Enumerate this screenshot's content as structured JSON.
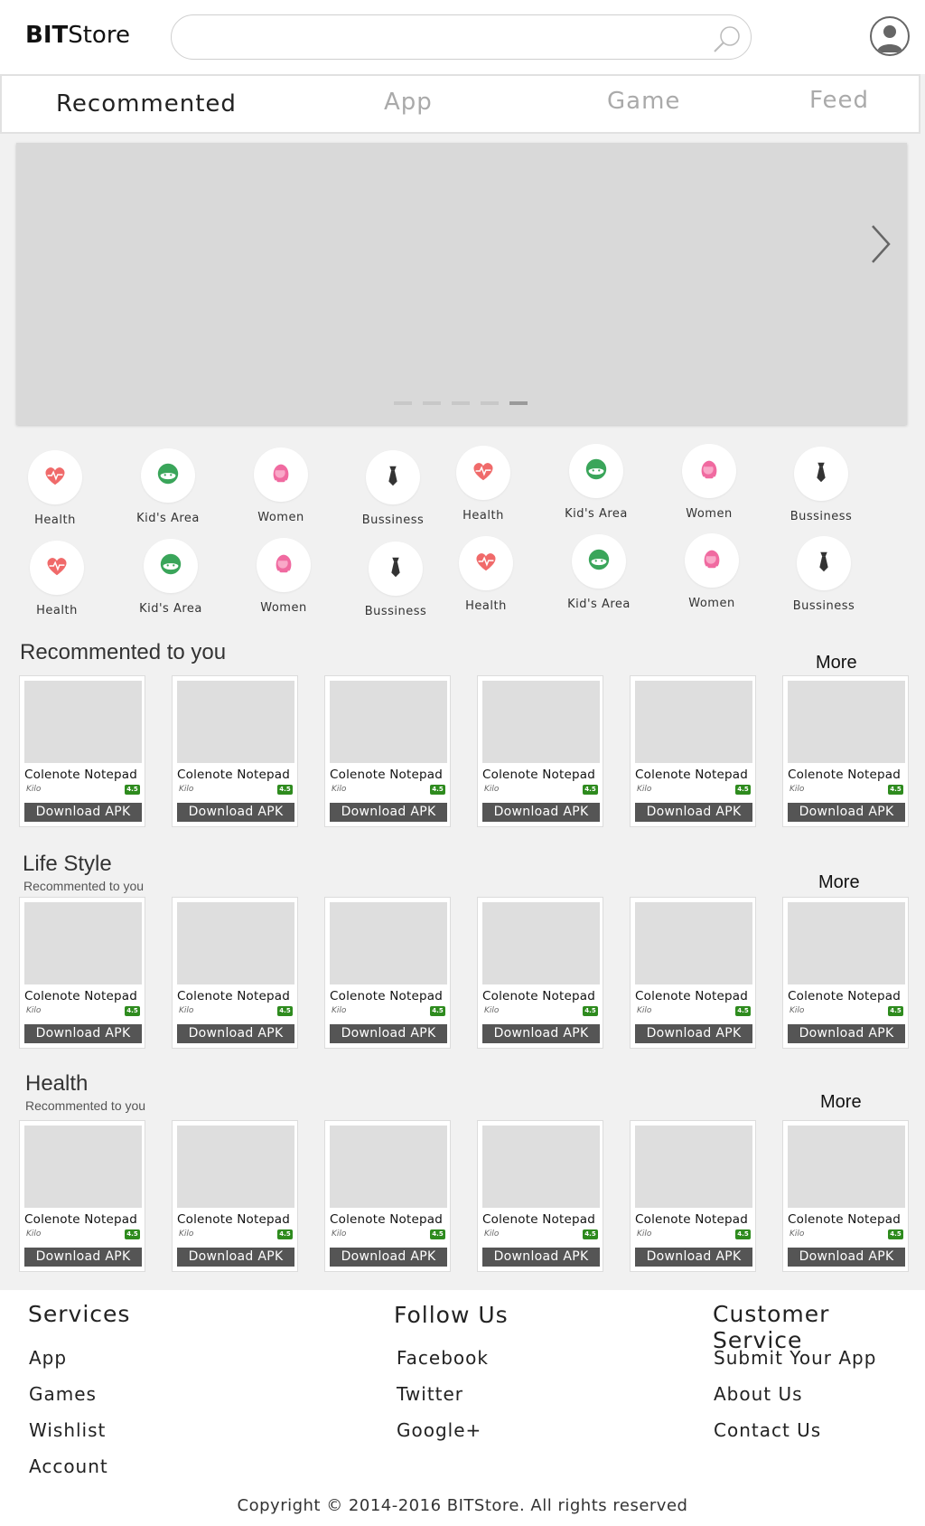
{
  "header": {
    "logo_bold": "BIT",
    "logo_rest": "Store",
    "search_placeholder": ""
  },
  "tabs": [
    {
      "label": "Recommented",
      "active": true
    },
    {
      "label": "App",
      "active": false
    },
    {
      "label": "Game",
      "active": false
    },
    {
      "label": "Feed",
      "active": false
    }
  ],
  "banner": {
    "slide_count": 5,
    "active_slide": 5
  },
  "categories": [
    {
      "label": "Health",
      "icon": "heart-pulse-icon"
    },
    {
      "label": "Kid's Area",
      "icon": "kid-face-icon"
    },
    {
      "label": "Women",
      "icon": "woman-icon"
    },
    {
      "label": "Bussiness",
      "icon": "tie-icon"
    },
    {
      "label": "Health",
      "icon": "heart-pulse-icon"
    },
    {
      "label": "Kid's Area",
      "icon": "kid-face-icon"
    },
    {
      "label": "Women",
      "icon": "woman-icon"
    },
    {
      "label": "Bussiness",
      "icon": "tie-icon"
    },
    {
      "label": "Health",
      "icon": "heart-pulse-icon"
    },
    {
      "label": "Kid's Area",
      "icon": "kid-face-icon"
    },
    {
      "label": "Women",
      "icon": "woman-icon"
    },
    {
      "label": "Bussiness",
      "icon": "tie-icon"
    },
    {
      "label": "Health",
      "icon": "heart-pulse-icon"
    },
    {
      "label": "Kid's Area",
      "icon": "kid-face-icon"
    },
    {
      "label": "Women",
      "icon": "woman-icon"
    },
    {
      "label": "Bussiness",
      "icon": "tie-icon"
    }
  ],
  "sections": [
    {
      "title": "Recommented to you",
      "subtitle": "",
      "more": "More",
      "apps": [
        {
          "name": "Colenote Notepad",
          "dev": "Kilo",
          "rating": "4.5",
          "button": "Download APK"
        },
        {
          "name": "Colenote Notepad",
          "dev": "Kilo",
          "rating": "4.5",
          "button": "Download APK"
        },
        {
          "name": "Colenote Notepad",
          "dev": "Kilo",
          "rating": "4.5",
          "button": "Download APK"
        },
        {
          "name": "Colenote Notepad",
          "dev": "Kilo",
          "rating": "4.5",
          "button": "Download APK"
        },
        {
          "name": "Colenote Notepad",
          "dev": "Kilo",
          "rating": "4.5",
          "button": "Download APK"
        },
        {
          "name": "Colenote Notepad",
          "dev": "Kilo",
          "rating": "4.5",
          "button": "Download APK"
        }
      ]
    },
    {
      "title": "Life Style",
      "subtitle": "Recommented to you",
      "more": "More",
      "apps": [
        {
          "name": "Colenote Notepad",
          "dev": "Kilo",
          "rating": "4.5",
          "button": "Download APK"
        },
        {
          "name": "Colenote Notepad",
          "dev": "Kilo",
          "rating": "4.5",
          "button": "Download APK"
        },
        {
          "name": "Colenote Notepad",
          "dev": "Kilo",
          "rating": "4.5",
          "button": "Download APK"
        },
        {
          "name": "Colenote Notepad",
          "dev": "Kilo",
          "rating": "4.5",
          "button": "Download APK"
        },
        {
          "name": "Colenote Notepad",
          "dev": "Kilo",
          "rating": "4.5",
          "button": "Download APK"
        },
        {
          "name": "Colenote Notepad",
          "dev": "Kilo",
          "rating": "4.5",
          "button": "Download APK"
        }
      ]
    },
    {
      "title": "Health",
      "subtitle": "Recommented to you",
      "more": "More",
      "apps": [
        {
          "name": "Colenote Notepad",
          "dev": "Kilo",
          "rating": "4.5",
          "button": "Download APK"
        },
        {
          "name": "Colenote Notepad",
          "dev": "Kilo",
          "rating": "4.5",
          "button": "Download APK"
        },
        {
          "name": "Colenote Notepad",
          "dev": "Kilo",
          "rating": "4.5",
          "button": "Download APK"
        },
        {
          "name": "Colenote Notepad",
          "dev": "Kilo",
          "rating": "4.5",
          "button": "Download APK"
        },
        {
          "name": "Colenote Notepad",
          "dev": "Kilo",
          "rating": "4.5",
          "button": "Download APK"
        },
        {
          "name": "Colenote Notepad",
          "dev": "Kilo",
          "rating": "4.5",
          "button": "Download APK"
        }
      ]
    }
  ],
  "footer": {
    "columns": [
      {
        "heading": "Services",
        "links": [
          "App",
          "Games",
          "Wishlist",
          "Account"
        ]
      },
      {
        "heading": "Follow Us",
        "links": [
          "Facebook",
          "Twitter",
          "Google+"
        ]
      },
      {
        "heading": "Customer Service",
        "links": [
          "Submit Your App",
          "About Us",
          "Contact Us"
        ]
      }
    ],
    "copyright": "Copyright © 2014-2016 BITStore. All rights reserved"
  },
  "colors": {
    "rating_badge": "#2e8b1e",
    "button_bg": "#555555",
    "health_icon": "#f06a6a",
    "kid_icon": "#3aa55a",
    "women_icon": "#f06aa0",
    "business_icon": "#333333"
  }
}
